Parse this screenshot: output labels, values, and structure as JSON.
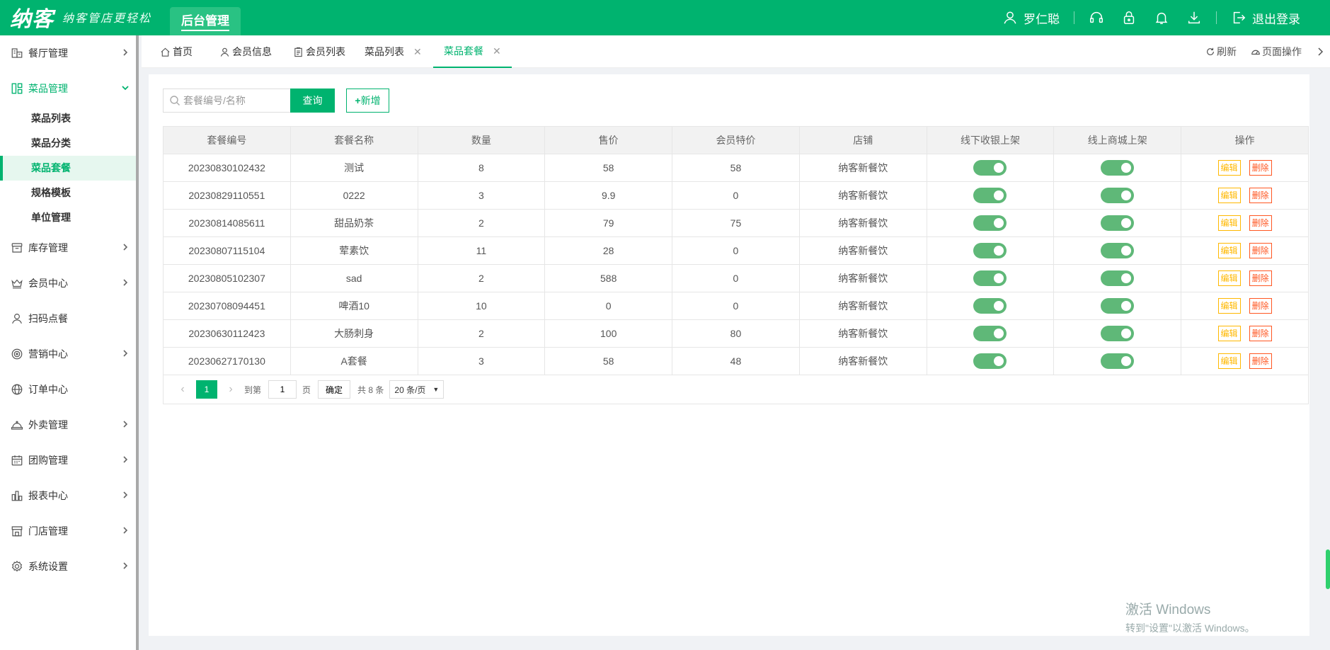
{
  "brand": {
    "name": "纳客",
    "slogan": "纳客管店更轻松"
  },
  "topbar": {
    "tab_label": "后台管理",
    "user_name": "罗仁聪",
    "logout_label": "退出登录"
  },
  "sidebar": {
    "items": [
      {
        "label": "餐厅管理",
        "icon": "shop-icon",
        "chevron": true
      },
      {
        "label": "菜品管理",
        "icon": "dish-icon",
        "chevron": true,
        "expanded": true
      },
      {
        "label": "库存管理",
        "icon": "box-icon",
        "chevron": true
      },
      {
        "label": "会员中心",
        "icon": "crown-icon",
        "chevron": true
      },
      {
        "label": "扫码点餐",
        "icon": "user-icon",
        "chevron": false
      },
      {
        "label": "营销中心",
        "icon": "target-icon",
        "chevron": true
      },
      {
        "label": "订单中心",
        "icon": "globe-icon",
        "chevron": false
      },
      {
        "label": "外卖管理",
        "icon": "cloche-icon",
        "chevron": true
      },
      {
        "label": "团购管理",
        "icon": "calendar-icon",
        "chevron": true
      },
      {
        "label": "报表中心",
        "icon": "chart-icon",
        "chevron": true
      },
      {
        "label": "门店管理",
        "icon": "store-icon",
        "chevron": true
      },
      {
        "label": "系统设置",
        "icon": "gear-icon",
        "chevron": true
      }
    ],
    "subitems": [
      "菜品列表",
      "菜品分类",
      "菜品套餐",
      "规格模板",
      "单位管理"
    ],
    "active_sub": "菜品套餐"
  },
  "tabs": [
    {
      "label": "首页",
      "icon": "home-icon",
      "closable": false
    },
    {
      "label": "会员信息",
      "icon": "user-icon",
      "closable": false
    },
    {
      "label": "会员列表",
      "icon": "clipboard-icon",
      "closable": false
    },
    {
      "label": "菜品列表",
      "icon": "",
      "closable": true
    },
    {
      "label": "菜品套餐",
      "icon": "",
      "closable": true,
      "active": true
    }
  ],
  "tab_actions": {
    "refresh": "刷新",
    "page_ops": "页面操作"
  },
  "search": {
    "placeholder": "套餐编号/名称",
    "query_label": "查询",
    "add_label": "新增"
  },
  "table": {
    "columns": [
      "套餐编号",
      "套餐名称",
      "数量",
      "售价",
      "会员特价",
      "店铺",
      "线下收银上架",
      "线上商城上架",
      "操作"
    ],
    "rows": [
      {
        "code": "20230830102432",
        "name": "测试",
        "qty": "8",
        "price": "58",
        "member_price": "58",
        "shop": "纳客新餐饮",
        "offline_on": true,
        "online_on": true
      },
      {
        "code": "20230829110551",
        "name": "0222",
        "qty": "3",
        "price": "9.9",
        "member_price": "0",
        "shop": "纳客新餐饮",
        "offline_on": true,
        "online_on": true
      },
      {
        "code": "20230814085611",
        "name": "甜品奶茶",
        "qty": "2",
        "price": "79",
        "member_price": "75",
        "shop": "纳客新餐饮",
        "offline_on": true,
        "online_on": true
      },
      {
        "code": "20230807115104",
        "name": "荤素饮",
        "qty": "11",
        "price": "28",
        "member_price": "0",
        "shop": "纳客新餐饮",
        "offline_on": true,
        "online_on": true
      },
      {
        "code": "20230805102307",
        "name": "sad",
        "qty": "2",
        "price": "588",
        "member_price": "0",
        "shop": "纳客新餐饮",
        "offline_on": true,
        "online_on": true
      },
      {
        "code": "20230708094451",
        "name": "啤酒10",
        "qty": "10",
        "price": "0",
        "member_price": "0",
        "shop": "纳客新餐饮",
        "offline_on": true,
        "online_on": true
      },
      {
        "code": "20230630112423",
        "name": "大肠刺身",
        "qty": "2",
        "price": "100",
        "member_price": "80",
        "shop": "纳客新餐饮",
        "offline_on": true,
        "online_on": true
      },
      {
        "code": "20230627170130",
        "name": "A套餐",
        "qty": "3",
        "price": "58",
        "member_price": "48",
        "shop": "纳客新餐饮",
        "offline_on": true,
        "online_on": true
      }
    ],
    "edit_label": "编辑",
    "delete_label": "删除"
  },
  "pager": {
    "current": "1",
    "goto_label": "到第",
    "goto_value": "1",
    "page_unit": "页",
    "confirm_label": "确定",
    "total_label": "共 8 条",
    "page_size": "20 条/页"
  },
  "watermark": {
    "line1": "激活 Windows",
    "line2": "转到\"设置\"以激活 Windows。"
  },
  "colors": {
    "brand": "#00b36f",
    "switch_on": "#5fb878",
    "edit": "#ffb800",
    "delete": "#ff5722"
  }
}
